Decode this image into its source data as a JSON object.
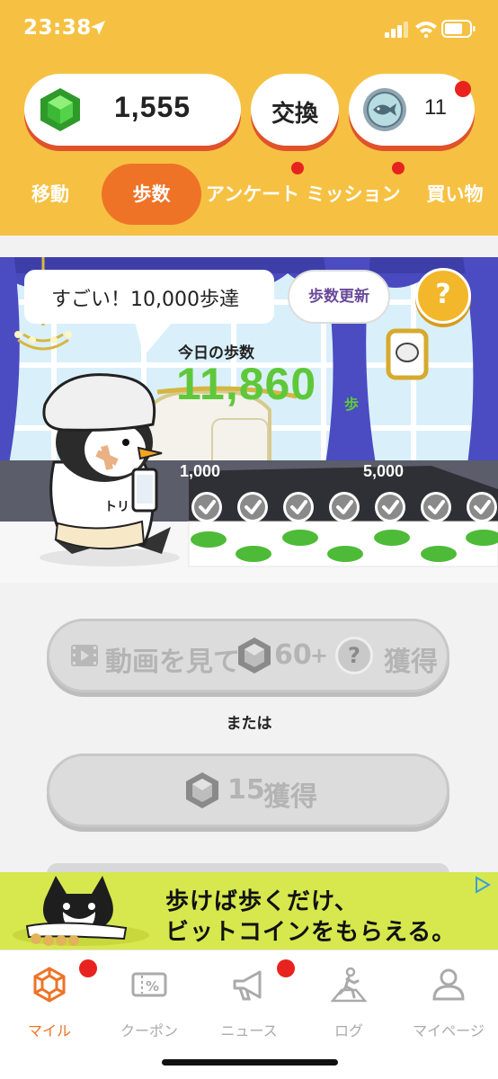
{
  "status_bar": {
    "time": "23:38"
  },
  "header": {
    "gem_count": "1,555",
    "exchange_label": "交換",
    "coin_count": "11",
    "tabs": [
      {
        "label": "移動",
        "active": false
      },
      {
        "label": "歩数",
        "active": true
      },
      {
        "label": "アンケート",
        "active": false
      },
      {
        "label": "ミッション",
        "active": false
      },
      {
        "label": "買い物",
        "active": false
      }
    ]
  },
  "stage": {
    "bubble_text": "すごい！10,000歩達",
    "update_label": "歩数更新",
    "help_label": "?",
    "today_label": "今日の歩数",
    "steps_value": "11,860",
    "steps_unit": "歩",
    "milestones": [
      "1,000",
      "5,000"
    ],
    "mascot_logo": "トリ"
  },
  "actions": {
    "video_label": "動画を見て",
    "video_amount": "60",
    "plus": "+",
    "video_suffix": "獲得",
    "mystery": "?",
    "or_label": "または",
    "get_amount": "15",
    "get_suffix": "獲得"
  },
  "ad": {
    "line1": "歩けば歩くだけ、",
    "line2": "ビットコインをもらえる。"
  },
  "bottom_nav": [
    {
      "label": "マイル",
      "icon": "gem-outline-icon",
      "active": true
    },
    {
      "label": "クーポン",
      "icon": "coupon-icon",
      "active": false
    },
    {
      "label": "ニュース",
      "icon": "megaphone-icon",
      "active": false
    },
    {
      "label": "ログ",
      "icon": "walking-log-icon",
      "active": false
    },
    {
      "label": "マイページ",
      "icon": "person-icon",
      "active": false
    }
  ],
  "colors": {
    "header_bg": "#f6c142",
    "accent_orange": "#ee7327",
    "steps_green": "#5fc83a",
    "badge_red": "#e8231f"
  }
}
